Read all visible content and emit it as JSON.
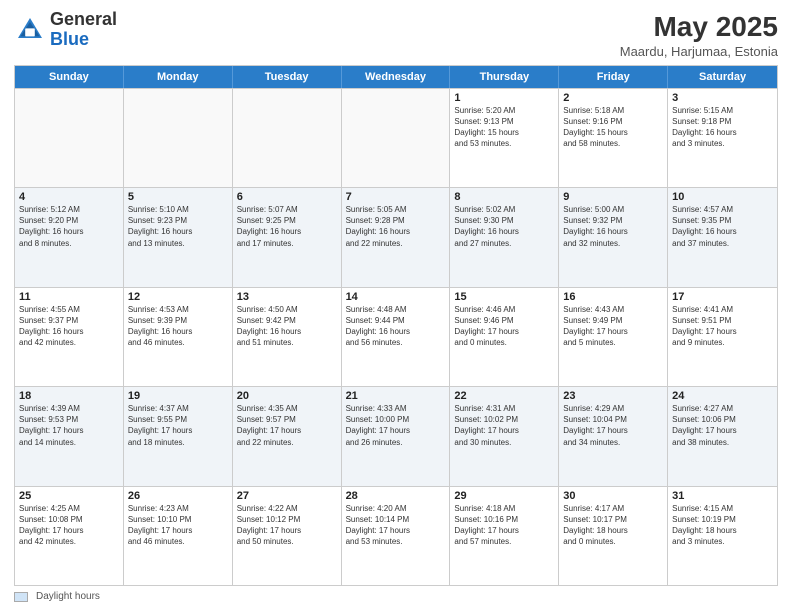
{
  "header": {
    "logo_general": "General",
    "logo_blue": "Blue",
    "month_year": "May 2025",
    "location": "Maardu, Harjumaa, Estonia"
  },
  "weekdays": [
    "Sunday",
    "Monday",
    "Tuesday",
    "Wednesday",
    "Thursday",
    "Friday",
    "Saturday"
  ],
  "legend_label": "Daylight hours",
  "weeks": [
    [
      {
        "day": "",
        "info": "",
        "empty": true
      },
      {
        "day": "",
        "info": "",
        "empty": true
      },
      {
        "day": "",
        "info": "",
        "empty": true
      },
      {
        "day": "",
        "info": "",
        "empty": true
      },
      {
        "day": "1",
        "info": "Sunrise: 5:20 AM\nSunset: 9:13 PM\nDaylight: 15 hours\nand 53 minutes.",
        "empty": false
      },
      {
        "day": "2",
        "info": "Sunrise: 5:18 AM\nSunset: 9:16 PM\nDaylight: 15 hours\nand 58 minutes.",
        "empty": false
      },
      {
        "day": "3",
        "info": "Sunrise: 5:15 AM\nSunset: 9:18 PM\nDaylight: 16 hours\nand 3 minutes.",
        "empty": false
      }
    ],
    [
      {
        "day": "4",
        "info": "Sunrise: 5:12 AM\nSunset: 9:20 PM\nDaylight: 16 hours\nand 8 minutes.",
        "empty": false
      },
      {
        "day": "5",
        "info": "Sunrise: 5:10 AM\nSunset: 9:23 PM\nDaylight: 16 hours\nand 13 minutes.",
        "empty": false
      },
      {
        "day": "6",
        "info": "Sunrise: 5:07 AM\nSunset: 9:25 PM\nDaylight: 16 hours\nand 17 minutes.",
        "empty": false
      },
      {
        "day": "7",
        "info": "Sunrise: 5:05 AM\nSunset: 9:28 PM\nDaylight: 16 hours\nand 22 minutes.",
        "empty": false
      },
      {
        "day": "8",
        "info": "Sunrise: 5:02 AM\nSunset: 9:30 PM\nDaylight: 16 hours\nand 27 minutes.",
        "empty": false
      },
      {
        "day": "9",
        "info": "Sunrise: 5:00 AM\nSunset: 9:32 PM\nDaylight: 16 hours\nand 32 minutes.",
        "empty": false
      },
      {
        "day": "10",
        "info": "Sunrise: 4:57 AM\nSunset: 9:35 PM\nDaylight: 16 hours\nand 37 minutes.",
        "empty": false
      }
    ],
    [
      {
        "day": "11",
        "info": "Sunrise: 4:55 AM\nSunset: 9:37 PM\nDaylight: 16 hours\nand 42 minutes.",
        "empty": false
      },
      {
        "day": "12",
        "info": "Sunrise: 4:53 AM\nSunset: 9:39 PM\nDaylight: 16 hours\nand 46 minutes.",
        "empty": false
      },
      {
        "day": "13",
        "info": "Sunrise: 4:50 AM\nSunset: 9:42 PM\nDaylight: 16 hours\nand 51 minutes.",
        "empty": false
      },
      {
        "day": "14",
        "info": "Sunrise: 4:48 AM\nSunset: 9:44 PM\nDaylight: 16 hours\nand 56 minutes.",
        "empty": false
      },
      {
        "day": "15",
        "info": "Sunrise: 4:46 AM\nSunset: 9:46 PM\nDaylight: 17 hours\nand 0 minutes.",
        "empty": false
      },
      {
        "day": "16",
        "info": "Sunrise: 4:43 AM\nSunset: 9:49 PM\nDaylight: 17 hours\nand 5 minutes.",
        "empty": false
      },
      {
        "day": "17",
        "info": "Sunrise: 4:41 AM\nSunset: 9:51 PM\nDaylight: 17 hours\nand 9 minutes.",
        "empty": false
      }
    ],
    [
      {
        "day": "18",
        "info": "Sunrise: 4:39 AM\nSunset: 9:53 PM\nDaylight: 17 hours\nand 14 minutes.",
        "empty": false
      },
      {
        "day": "19",
        "info": "Sunrise: 4:37 AM\nSunset: 9:55 PM\nDaylight: 17 hours\nand 18 minutes.",
        "empty": false
      },
      {
        "day": "20",
        "info": "Sunrise: 4:35 AM\nSunset: 9:57 PM\nDaylight: 17 hours\nand 22 minutes.",
        "empty": false
      },
      {
        "day": "21",
        "info": "Sunrise: 4:33 AM\nSunset: 10:00 PM\nDaylight: 17 hours\nand 26 minutes.",
        "empty": false
      },
      {
        "day": "22",
        "info": "Sunrise: 4:31 AM\nSunset: 10:02 PM\nDaylight: 17 hours\nand 30 minutes.",
        "empty": false
      },
      {
        "day": "23",
        "info": "Sunrise: 4:29 AM\nSunset: 10:04 PM\nDaylight: 17 hours\nand 34 minutes.",
        "empty": false
      },
      {
        "day": "24",
        "info": "Sunrise: 4:27 AM\nSunset: 10:06 PM\nDaylight: 17 hours\nand 38 minutes.",
        "empty": false
      }
    ],
    [
      {
        "day": "25",
        "info": "Sunrise: 4:25 AM\nSunset: 10:08 PM\nDaylight: 17 hours\nand 42 minutes.",
        "empty": false
      },
      {
        "day": "26",
        "info": "Sunrise: 4:23 AM\nSunset: 10:10 PM\nDaylight: 17 hours\nand 46 minutes.",
        "empty": false
      },
      {
        "day": "27",
        "info": "Sunrise: 4:22 AM\nSunset: 10:12 PM\nDaylight: 17 hours\nand 50 minutes.",
        "empty": false
      },
      {
        "day": "28",
        "info": "Sunrise: 4:20 AM\nSunset: 10:14 PM\nDaylight: 17 hours\nand 53 minutes.",
        "empty": false
      },
      {
        "day": "29",
        "info": "Sunrise: 4:18 AM\nSunset: 10:16 PM\nDaylight: 17 hours\nand 57 minutes.",
        "empty": false
      },
      {
        "day": "30",
        "info": "Sunrise: 4:17 AM\nSunset: 10:17 PM\nDaylight: 18 hours\nand 0 minutes.",
        "empty": false
      },
      {
        "day": "31",
        "info": "Sunrise: 4:15 AM\nSunset: 10:19 PM\nDaylight: 18 hours\nand 3 minutes.",
        "empty": false
      }
    ]
  ]
}
